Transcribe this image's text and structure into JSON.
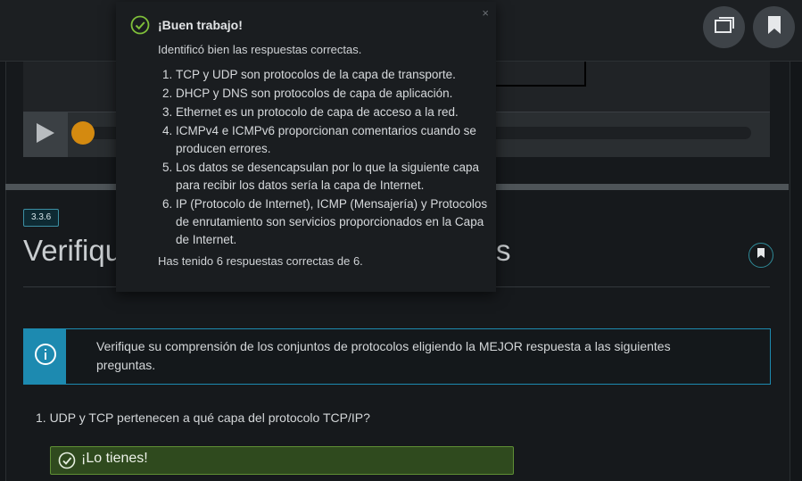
{
  "topbar": {
    "icons": [
      "windows-icon",
      "bookmark-icon"
    ]
  },
  "section": {
    "badge": "3.3.6",
    "title_visible_start": "Verifiqu",
    "title_visible_end": "s"
  },
  "info": {
    "text": "Verifique su comprensión de los conjuntos de protocolos eligiendo la MEJOR respuesta a las siguientes preguntas."
  },
  "quiz": {
    "question": "1. UDP y TCP pertenecen a qué capa del protocolo TCP/IP?",
    "answer_feedback": "¡Lo tienes!"
  },
  "popup": {
    "title": "¡Buen trabajo!",
    "close": "×",
    "intro": "Identificó bien las respuestas correctas.",
    "items": [
      "TCP y UDP son protocolos de la capa de transporte.",
      "DHCP y DNS son protocolos de capa de aplicación.",
      "Ethernet es un protocolo de capa de acceso a la red.",
      "ICMPv4 e ICMPv6 proporcionan comentarios cuando se producen errores.",
      "Los datos se desencapsulan por lo que la siguiente capa para recibir los datos sería la capa de Internet.",
      "IP (Protocolo de Internet), ICMP (Mensajería) y Protocolos de enrutamiento son servicios proporcionados en la Capa de Internet."
    ],
    "footer": "Has tenido 6 respuestas correctas de 6."
  },
  "colors": {
    "accent": "#1d8ab0",
    "success": "#5f8f35",
    "progress": "#d48a10"
  }
}
